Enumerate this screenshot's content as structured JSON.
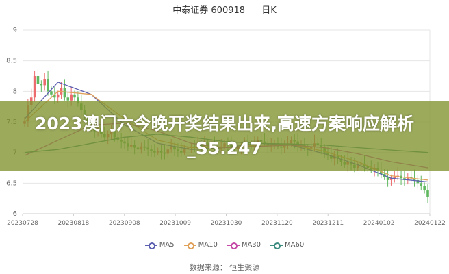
{
  "title": {
    "stock": "中泰证券 600918",
    "period": "日K"
  },
  "overlay_headline": "2023澳门六今晚开奖结果出来,高速方案响应解析_S5.247",
  "source_label": "数据来源： 恒生聚源",
  "colors": {
    "up": "#ec6b6e",
    "down": "#5fb85f",
    "ma5": "#5d5fb0",
    "ma10": "#e0a15a",
    "ma30": "#c64aa8",
    "ma60": "#3c8c7f"
  },
  "chart_data": {
    "type": "candlestick",
    "title": "中泰证券 600918",
    "period": "日K",
    "ylim": [
      6,
      9
    ],
    "y_ticks": [
      "9",
      "8.5",
      "8",
      "7.5",
      "7",
      "6.5",
      "6"
    ],
    "x_ticks": [
      "20230728",
      "20230818",
      "20230908",
      "20231009",
      "20231030",
      "20231120",
      "20231211",
      "20240102",
      "20240122"
    ],
    "legend": [
      "MA5",
      "MA10",
      "MA30",
      "MA60"
    ],
    "grid": "horizontal",
    "closes": [
      7.52,
      7.78,
      7.9,
      8.25,
      8.12,
      8.1,
      8.2,
      8.0,
      7.95,
      7.9,
      7.95,
      8.05,
      7.9,
      7.85,
      7.95,
      7.9,
      7.8,
      7.7,
      7.6,
      7.5,
      7.4,
      7.35,
      7.4,
      7.3,
      7.25,
      7.3,
      7.35,
      7.25,
      7.2,
      7.18,
      7.15,
      7.1,
      7.12,
      7.08,
      7.05,
      7.1,
      7.08,
      7.05,
      7.02,
      7.0,
      7.02,
      7.0,
      6.98,
      7.05,
      7.1,
      7.05,
      7.02,
      7.0,
      7.05,
      7.08,
      7.1,
      7.08,
      7.12,
      7.1,
      7.15,
      7.1,
      7.12,
      7.08,
      7.05,
      7.1,
      7.15,
      7.12,
      7.1,
      7.05,
      7.08,
      7.1,
      7.15,
      7.12,
      7.1,
      7.15,
      7.2,
      7.18,
      7.15,
      7.1,
      7.12,
      7.15,
      7.1,
      7.08,
      7.12,
      7.15,
      7.2,
      7.18,
      7.1,
      7.12,
      7.08,
      7.05,
      7.1,
      7.15,
      7.12,
      7.08,
      7.0,
      6.95,
      6.9,
      6.95,
      6.9,
      6.85,
      6.8,
      6.85,
      6.8,
      6.75,
      6.8,
      6.82,
      6.78,
      6.75,
      6.72,
      6.75,
      6.7,
      6.65,
      6.6,
      6.55,
      6.58,
      6.6,
      6.62,
      6.58,
      6.55,
      6.6,
      6.58,
      6.55,
      6.5,
      6.45,
      6.38,
      6.28
    ],
    "ma_values": {
      "MA5": {
        "x": [
          0,
          10,
          20,
          30,
          40,
          50,
          60,
          70,
          80,
          90,
          100,
          110,
          121
        ],
        "y": [
          7.55,
          8.15,
          7.95,
          7.45,
          7.15,
          7.05,
          7.08,
          7.15,
          7.12,
          6.98,
          6.8,
          6.58,
          6.52
        ]
      },
      "MA10": {
        "x": [
          0,
          10,
          20,
          30,
          40,
          50,
          60,
          70,
          80,
          90,
          100,
          110,
          121
        ],
        "y": [
          7.5,
          8.0,
          7.95,
          7.55,
          7.2,
          7.08,
          7.08,
          7.12,
          7.13,
          7.02,
          6.85,
          6.62,
          6.55
        ]
      },
      "MA30": {
        "x": [
          0,
          10,
          20,
          30,
          40,
          50,
          60,
          70,
          80,
          90,
          100,
          110,
          121
        ],
        "y": [
          6.95,
          7.2,
          7.45,
          7.48,
          7.35,
          7.15,
          7.08,
          7.1,
          7.12,
          7.08,
          6.98,
          6.85,
          6.75
        ]
      },
      "MA60": {
        "x": [
          0,
          10,
          20,
          30,
          40,
          50,
          60,
          70,
          80,
          90,
          100,
          110,
          121
        ],
        "y": [
          7.0,
          7.05,
          7.15,
          7.25,
          7.3,
          7.25,
          7.18,
          7.15,
          7.14,
          7.12,
          7.08,
          7.04,
          7.0
        ]
      }
    }
  }
}
